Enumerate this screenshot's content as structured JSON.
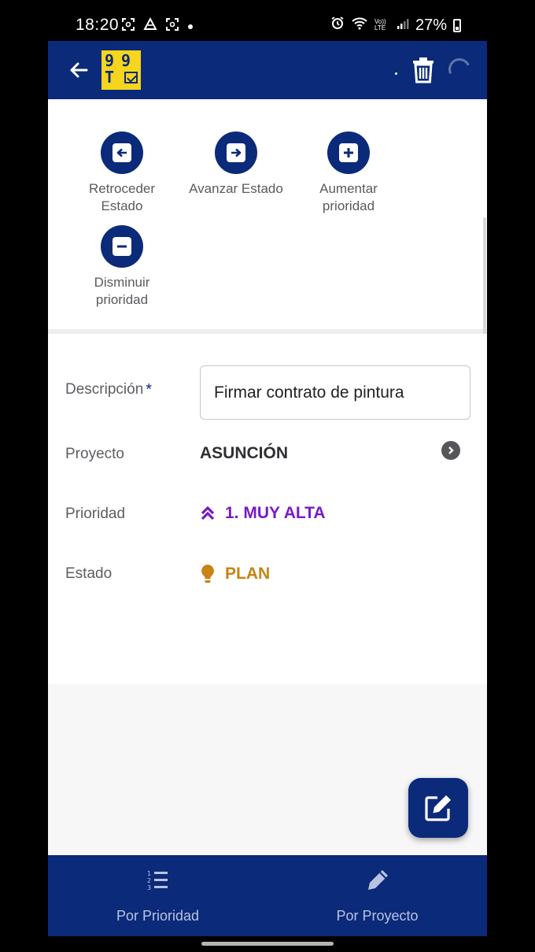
{
  "status_bar": {
    "time": "18:20",
    "volte": "Vo)) LTE",
    "battery": "27%"
  },
  "app_bar": {
    "logo_top": "99",
    "logo_bottom": "T",
    "accent": "#0b2a7a",
    "logo_color": "#f7d51d"
  },
  "actions": [
    {
      "label": "Retroceder Estado",
      "icon": "arrow-left-icon"
    },
    {
      "label": "Avanzar Estado",
      "icon": "arrow-right-icon"
    },
    {
      "label": "Aumentar prioridad",
      "icon": "plus-icon"
    },
    {
      "label": "Disminuir prioridad",
      "icon": "minus-icon"
    }
  ],
  "fields": {
    "descripcion": {
      "label": "Descripción",
      "required_mark": "*",
      "value": "Firmar contrato de pintura"
    },
    "proyecto": {
      "label": "Proyecto",
      "value": "ASUNCIÓN"
    },
    "prioridad": {
      "label": "Prioridad",
      "value": "1. MUY ALTA",
      "color": "#7a18c8",
      "icon": "double-chevron-up-icon"
    },
    "estado": {
      "label": "Estado",
      "value": "PLAN",
      "color": "#c88312",
      "icon": "lightbulb-icon"
    }
  },
  "bottom_nav": [
    {
      "label": "Por Prioridad",
      "icon": "ordered-list-icon"
    },
    {
      "label": "Por Proyecto",
      "icon": "pencil-icon"
    }
  ]
}
